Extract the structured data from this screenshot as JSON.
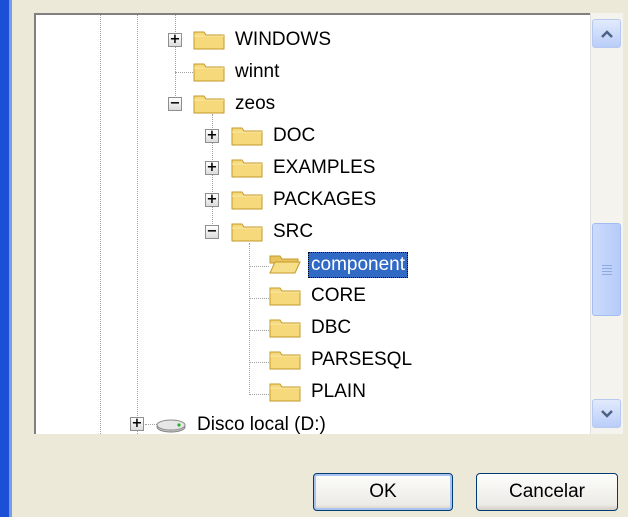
{
  "tree": {
    "items": [
      {
        "label": "WINDOWS",
        "icon": "folder-icon",
        "expander": "+"
      },
      {
        "label": "winnt",
        "icon": "folder-icon",
        "expander": ""
      },
      {
        "label": "zeos",
        "icon": "folder-icon",
        "expander": "−"
      },
      {
        "label": "DOC",
        "icon": "folder-icon",
        "expander": "+"
      },
      {
        "label": "EXAMPLES",
        "icon": "folder-icon",
        "expander": "+"
      },
      {
        "label": "PACKAGES",
        "icon": "folder-icon",
        "expander": "+"
      },
      {
        "label": "SRC",
        "icon": "folder-icon",
        "expander": "−"
      },
      {
        "label": "component",
        "icon": "open-folder-icon",
        "expander": "",
        "selected": true
      },
      {
        "label": "CORE",
        "icon": "folder-icon",
        "expander": ""
      },
      {
        "label": "DBC",
        "icon": "folder-icon",
        "expander": ""
      },
      {
        "label": "PARSESQL",
        "icon": "folder-icon",
        "expander": ""
      },
      {
        "label": "PLAIN",
        "icon": "folder-icon",
        "expander": ""
      },
      {
        "label": "Disco local (D:)",
        "icon": "drive-icon",
        "expander": "+"
      }
    ]
  },
  "buttons": {
    "ok": "OK",
    "cancel": "Cancelar"
  },
  "colors": {
    "selection": "#316ac5",
    "folder": "#f5d97a",
    "folder_outline": "#c49a2a",
    "xp_blue": "#1a4fd6"
  }
}
